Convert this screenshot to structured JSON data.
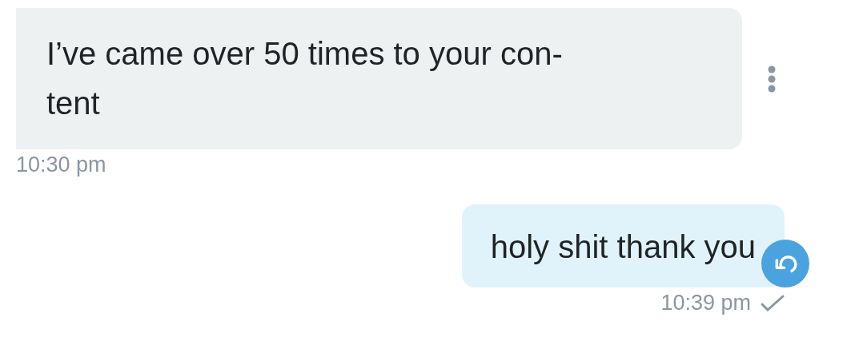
{
  "messages": [
    {
      "kind": "incoming",
      "text": "I’ve came over 50 times to your con-tent",
      "time": "10:30 pm",
      "has_menu": true
    },
    {
      "kind": "outgoing",
      "text": "holy shit thank you",
      "time": "10:39 pm",
      "has_undo": true,
      "read": true
    }
  ]
}
